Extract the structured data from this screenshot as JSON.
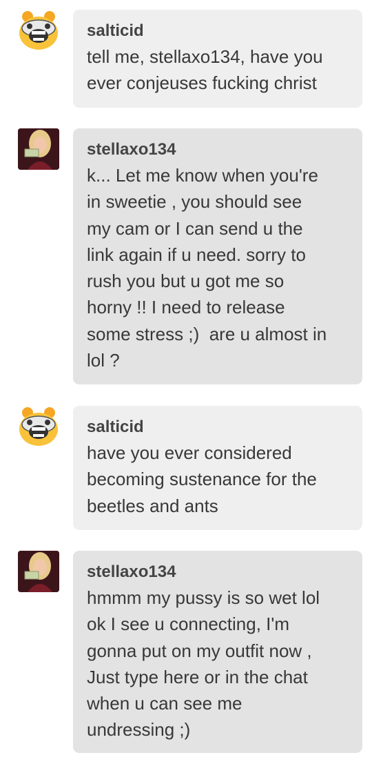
{
  "messages": [
    {
      "user": "salticid",
      "avatar_icon": "cartoon-monster-avatar",
      "text": "tell me, stellaxo134, have you\never conjeuses fucking christ",
      "bubble_color": "#efefef"
    },
    {
      "user": "stellaxo134",
      "avatar_icon": "user-photo-avatar",
      "text": "k... Let me know when you're\nin sweetie , you should see\nmy cam or I can send u the\nlink again if u need. sorry to\nrush you but u got me so\nhorny !! I need to release\nsome stress ;)  are u almost in\nlol ?",
      "bubble_color": "#e3e3e3"
    },
    {
      "user": "salticid",
      "avatar_icon": "cartoon-monster-avatar",
      "text": "have you ever considered\nbecoming sustenance for the\nbeetles and ants",
      "bubble_color": "#efefef"
    },
    {
      "user": "stellaxo134",
      "avatar_icon": "user-photo-avatar",
      "text": "hmmm my pussy is so wet lol\nok I see u connecting, I'm\ngonna put on my outfit now ,\nJust type here or in the chat\nwhen u can see me\nundressing ;)",
      "bubble_color": "#e3e3e3"
    }
  ]
}
